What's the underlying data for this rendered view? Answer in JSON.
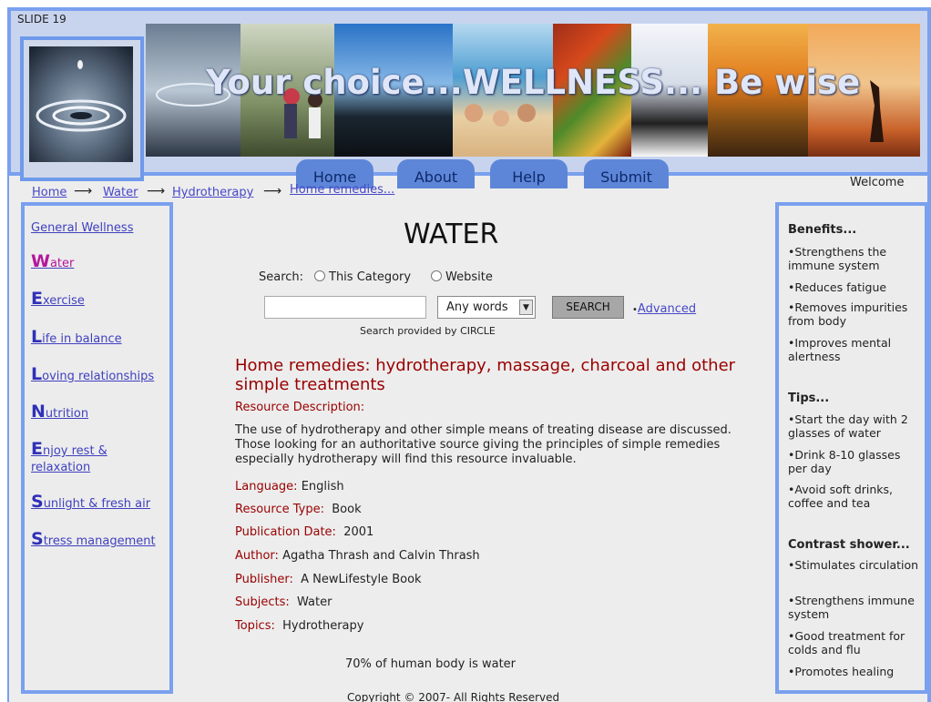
{
  "slide_label": "SLIDE 19",
  "banner": {
    "title": "Your choice...WELLNESS... Be wise"
  },
  "nav_tabs": [
    "Home",
    "About",
    "Help",
    "Submit"
  ],
  "welcome": "Welcome",
  "breadcrumbs": [
    "Home",
    "Water",
    "Hydrotherapy",
    "Home remedies..."
  ],
  "left_nav": {
    "general": "General Wellness",
    "items": [
      {
        "initial": "W",
        "rest": "ater"
      },
      {
        "initial": "E",
        "rest": "xercise"
      },
      {
        "initial": "L",
        "rest": "ife in balance"
      },
      {
        "initial": "L",
        "rest": "oving relationships"
      },
      {
        "initial": "N",
        "rest": "utrition"
      },
      {
        "initial": "E",
        "rest": "njoy rest &"
      },
      {
        "initial": "S",
        "rest": "unlight & fresh air"
      },
      {
        "initial": "S",
        "rest": "tress management"
      }
    ],
    "enjoy_line2": "relaxation"
  },
  "main": {
    "title": "WATER",
    "search_label": "Search:",
    "radio_category": "This Category",
    "radio_website": "Website",
    "search_value": "",
    "match_option": "Any words",
    "search_button": "SEARCH",
    "advanced": "Advanced",
    "provided_by": "Search provided by CIRCLE",
    "resource_title": "Home remedies:  hydrotherapy, massage, charcoal and other simple treatments",
    "description_label": "Resource Description:",
    "description": "The use of hydrotherapy and other simple means of treating disease are discussed.  Those looking for an authoritative source giving the principles of simple remedies especially hydrotherapy will find this resource invaluable.",
    "details": [
      {
        "label": "Language:",
        "value": "English"
      },
      {
        "label": "Resource Type:",
        "value": "Book"
      },
      {
        "label": "Publication Date:",
        "value": "2001"
      },
      {
        "label": "Author:",
        "value": "Agatha Thrash and Calvin Thrash"
      },
      {
        "label": "Publisher:",
        "value": "A NewLifestyle Book"
      },
      {
        "label": "Subjects:",
        "value": "Water"
      },
      {
        "label": "Topics:",
        "value": "Hydrotherapy"
      }
    ],
    "fact": "70% of human body is water",
    "copyright": "Copyright  © 2007- All Rights Reserved"
  },
  "right_panel": {
    "benefits_heading": "Benefits...",
    "benefits": [
      "Strengthens the immune system",
      "Reduces fatigue",
      "Removes impurities from body",
      "Improves mental alertness"
    ],
    "tips_heading": "Tips...",
    "tips": [
      "Start the day with 2 glasses of water",
      "Drink 8-10 glasses per day",
      "Avoid soft drinks, coffee and tea"
    ],
    "contrast_heading": "Contrast shower...",
    "contrast": [
      "Stimulates circulation",
      "Strengthens immune system",
      "Good treatment for colds and flu",
      "Promotes healing"
    ]
  },
  "colors": {
    "accent_blue": "#7aa0ee",
    "link": "#4040c0",
    "dark_red": "#990000",
    "pink_initial": "#b5169b"
  }
}
